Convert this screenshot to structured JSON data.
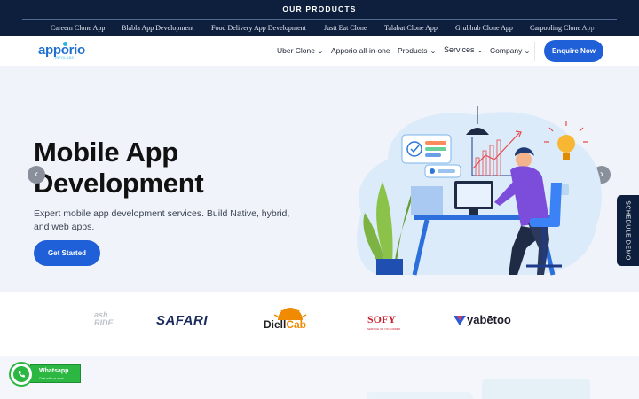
{
  "topbar": {
    "title": "OUR PRODUCTS",
    "links": [
      "Careem Clone App",
      "Blabla App Development",
      "Food Delivery App Development",
      "Justt Eat Clone",
      "Talabat Clone App",
      "Grubhub Clone App",
      "Carpooling Clone App"
    ]
  },
  "header": {
    "logo": "apporio",
    "logo_sub": "INFOLABS",
    "nav": {
      "uber_clone": "Uber Clone",
      "apporio_all_in_one": "Apporio all-in-one",
      "products": "Products",
      "services": "Services",
      "company": "Company"
    },
    "enquire": "Enquire Now"
  },
  "hero": {
    "title": "Mobile App Development",
    "subtitle": "Expert mobile app development services. Build Native, hybrid, and web apps.",
    "cta": "Get Started"
  },
  "schedule_demo": "SCHEDULE DEMO",
  "partners": {
    "cash_ride_top": "ash",
    "cash_ride_bottom": "RIDE",
    "safari": "SAFARI",
    "diell": "Diell",
    "cab": "Cab",
    "sofy": "SOFY",
    "sofy_sub": "SERVICE OF YOU ORDER",
    "yabetoo": "yabētoo"
  },
  "whatsapp": {
    "title": "Whatsapp",
    "subtitle": "Chat with us now!"
  },
  "colors": {
    "navy": "#0d1f3c",
    "primary_blue": "#1f5fd8",
    "whatsapp_green": "#2cb742"
  }
}
